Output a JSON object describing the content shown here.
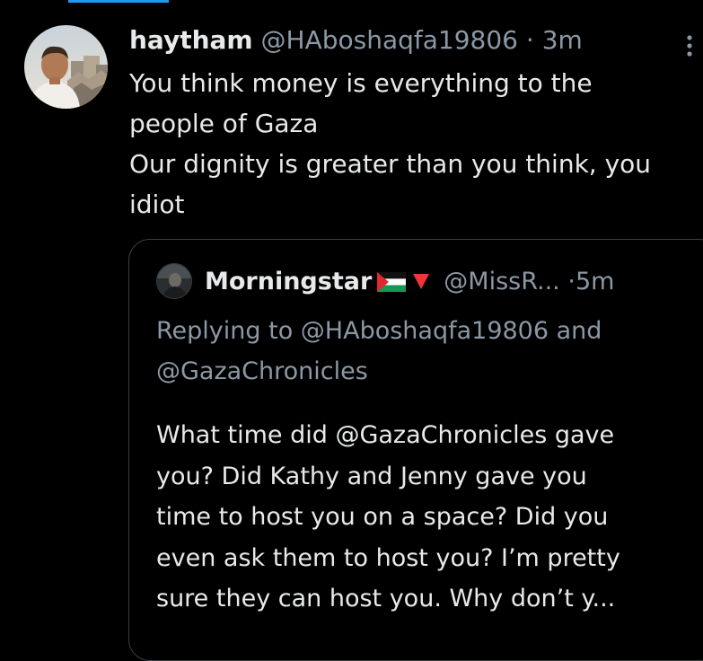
{
  "tweet": {
    "display_name": "haytham",
    "handle": "@HAboshaqfa19806",
    "separator": "·",
    "time": "3m",
    "text_lines": [
      "You think money is everything to the",
      "people of Gaza",
      "Our dignity is greater than you think, you",
      "idiot"
    ],
    "more_icon": "more-vertical-icon"
  },
  "quote": {
    "display_name": "Morningstar",
    "flag_icon": "palestine-flag-icon",
    "emoji_icon": "red-triangle-down-icon",
    "handle": "@MissR...",
    "separator": "·",
    "time": "5m",
    "reply_lines": [
      "Replying to @HAboshaqfa19806 and",
      "@GazaChronicles"
    ],
    "text_lines": [
      "What time did @GazaChronicles gave",
      "you? Did Kathy and Jenny gave you",
      "time to host you on a space? Did you",
      "even ask them to host you? I’m pretty",
      "sure they can host you. Why don’t y..."
    ]
  },
  "colors": {
    "background": "#000000",
    "primary_text": "#e7e9ea",
    "secondary_text": "#8b98a5",
    "border": "#3a3f44",
    "accent": "#1d9bf0",
    "flag_red": "#e0282e",
    "flag_green": "#149954",
    "triangle_red": "#f0343c"
  }
}
